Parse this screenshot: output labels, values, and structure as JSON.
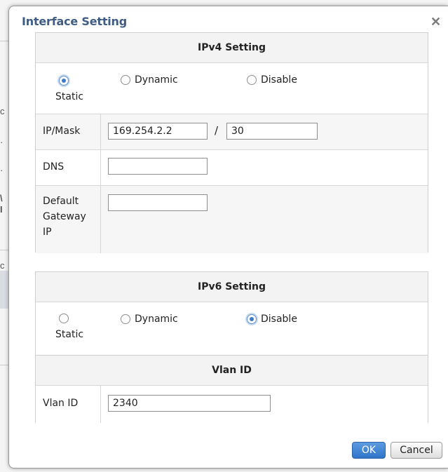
{
  "dialog": {
    "title": "Interface Setting",
    "close_glyph": "✕"
  },
  "ipv4": {
    "heading": "IPv4 Setting",
    "options": [
      {
        "label": "Static",
        "selected": true
      },
      {
        "label": "Dynamic",
        "selected": false
      },
      {
        "label": "Disable",
        "selected": false
      }
    ],
    "fields": {
      "ipmask_label": "IP/Mask",
      "ip_value": "169.254.2.2",
      "separator": "/",
      "mask_value": "30",
      "dns_label": "DNS",
      "dns_value": "",
      "gateway_label_1": "Default",
      "gateway_label_2": "Gateway",
      "gateway_label_3": "IP",
      "gateway_value": ""
    }
  },
  "ipv6": {
    "heading": "IPv6 Setting",
    "options": [
      {
        "label": "Static",
        "selected": false
      },
      {
        "label": "Dynamic",
        "selected": false
      },
      {
        "label": "Disable",
        "selected": true
      }
    ]
  },
  "vlan": {
    "heading": "Vlan ID",
    "label": "Vlan ID",
    "value": "2340"
  },
  "buttons": {
    "ok": "OK",
    "cancel": "Cancel"
  },
  "colors": {
    "title": "#3f5d84",
    "accent": "#3d7bc6",
    "ok_button": "#2f75c8"
  }
}
